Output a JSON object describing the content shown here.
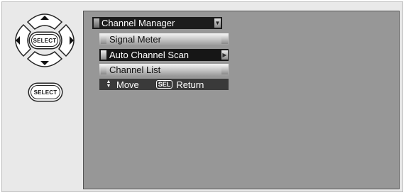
{
  "remote": {
    "select_label": "SELECT",
    "standalone_select_label": "SELECT",
    "arrows": {
      "up": "up-arrow-icon",
      "down": "down-arrow-icon",
      "left": "left-arrow-icon",
      "right": "right-arrow-icon"
    }
  },
  "menu": {
    "title": "Channel Manager",
    "items": [
      {
        "label": "Signal Meter",
        "selected": false
      },
      {
        "label": "Auto Channel Scan",
        "selected": true
      },
      {
        "label": "Channel List",
        "selected": false
      }
    ],
    "help": {
      "move_label": "Move",
      "sel_key": "SEL",
      "return_label": "Return"
    }
  },
  "colors": {
    "screen": "#979797",
    "selected": "#161616",
    "help_bar": "#3a3a3a"
  }
}
